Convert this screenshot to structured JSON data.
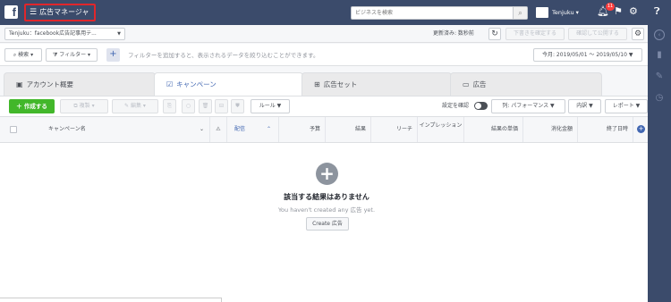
{
  "topbar": {
    "logo": "f",
    "menu_label": "広告マネージャ",
    "search_placeholder": "ビジネスを検索",
    "account_name": "Tenjuku",
    "notif_count": "11"
  },
  "subbar": {
    "account_selector": "Tenjuku：facebook広告記事用テ...",
    "updated_text": "更新済み: 数秒前",
    "review_label": "下書きを確定する",
    "publish_label": "確認して公開する"
  },
  "filterbar": {
    "search_label": "検索",
    "filter_label": "フィルター",
    "hint": "フィルターを追加すると、表示されるデータを絞り込むことができます。",
    "date_range": "今月: 2019/05/01 〜 2019/05/10"
  },
  "tabs": [
    {
      "label": "アカウント概要"
    },
    {
      "label": "キャンペーン"
    },
    {
      "label": "広告セット"
    },
    {
      "label": "広告"
    }
  ],
  "toolbar": {
    "create_label": "＋ 作成する",
    "duplicate_label": "複製",
    "edit_label": "編集",
    "rules_label": "ルール",
    "setting_label": "設定を確認",
    "columns_label": "列: パフォーマンス",
    "breakdown_label": "内訳",
    "report_label": "レポート"
  },
  "table": {
    "headers": {
      "name": "キャンペーン名",
      "delivery": "配信",
      "budget": "予算",
      "results": "結果",
      "reach": "リーチ",
      "impressions": "インプレッション",
      "cost_per_result": "結果の単価",
      "amount_spent": "消化金額",
      "end_date": "終了日時"
    }
  },
  "empty_state": {
    "title": "該当する結果はありません",
    "subtitle": "You haven't created any 広告 yet.",
    "button": "Create 広告"
  },
  "colors": {
    "topbar": "#3b4b6b",
    "accent": "#4267b2",
    "create": "#42b72a",
    "highlight_box": "#e0262b"
  }
}
